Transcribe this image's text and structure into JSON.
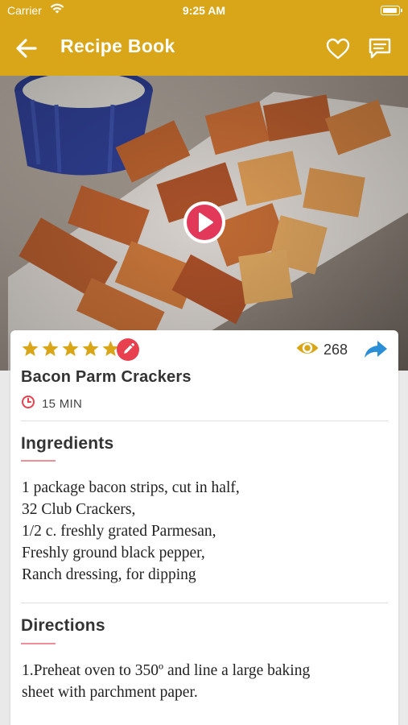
{
  "status_bar": {
    "carrier": "Carrier",
    "time": "9:25 AM"
  },
  "header": {
    "title": "Recipe Book",
    "back_icon": "arrow-left-icon",
    "favorite_icon": "heart-outline-icon",
    "comments_icon": "chat-bubble-icon"
  },
  "hero": {
    "play_icon": "play-circle-icon"
  },
  "recipe": {
    "rating": 5,
    "max_rating": 5,
    "views": "268",
    "name": "Bacon Parm Crackers",
    "time": "15 MIN"
  },
  "ingredients": {
    "heading": "Ingredients",
    "lines": [
      "1 package bacon strips, cut in half,",
      "32 Club Crackers,",
      "1/2 c. freshly grated Parmesan,",
      "Freshly ground black pepper,",
      "Ranch dressing, for dipping"
    ]
  },
  "directions": {
    "heading": "Directions",
    "lines": [
      "1.Preheat oven to 350º and line a large baking",
      "sheet with parchment paper."
    ]
  },
  "colors": {
    "brand": "#d9a619",
    "accent_red": "#e8404f",
    "star": "#d9a619",
    "share_blue": "#2a8fd6"
  }
}
